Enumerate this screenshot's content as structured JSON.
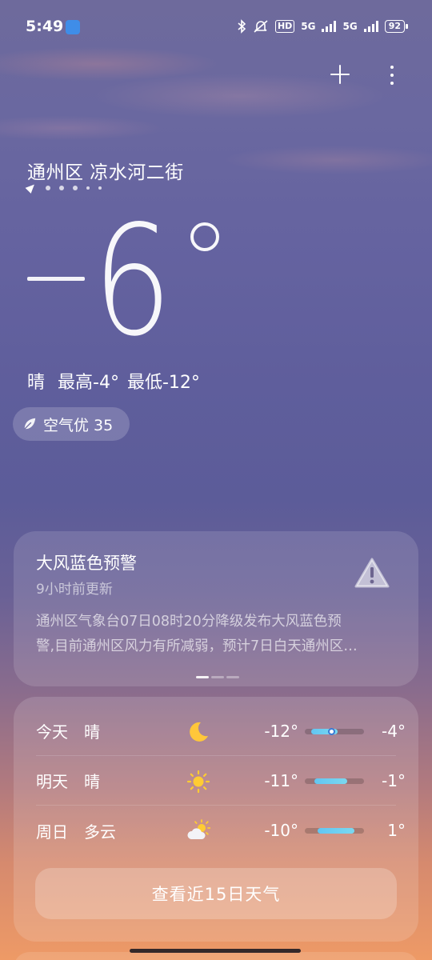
{
  "status_bar": {
    "time": "5:49",
    "hd_label": "HD",
    "network_1": "5G",
    "network_2": "5G",
    "battery": "92"
  },
  "location": {
    "name": "通州区 凉水河二街",
    "page_count": 6,
    "current_page": 0
  },
  "current": {
    "temperature_sign": "-",
    "temperature_value": "6",
    "condition": "晴",
    "high": "最高-4°",
    "low": "最低-12°",
    "aqi_label": "空气优 35"
  },
  "alert": {
    "title": "大风蓝色预警",
    "updated": "9小时前更新",
    "text_line1": "通州区气象台07日08时20分降级发布大风蓝色预",
    "text_line2": "警,目前通州区风力有所减弱，预计7日白天通州区…",
    "pager_count": 3,
    "pager_active": 0
  },
  "forecast": {
    "rows": [
      {
        "day": "今天",
        "condition": "晴",
        "icon": "moon-icon",
        "low": "-12°",
        "high": "-4°",
        "low_value": -12,
        "high_value": -4,
        "current_value": -6
      },
      {
        "day": "明天",
        "condition": "晴",
        "icon": "sun-icon",
        "low": "-11°",
        "high": "-1°",
        "low_value": -11,
        "high_value": -1
      },
      {
        "day": "周日",
        "condition": "多云",
        "icon": "partly-cloudy-icon",
        "low": "-10°",
        "high": "1°",
        "low_value": -10,
        "high_value": 1
      }
    ],
    "view15_label": "查看近15日天气"
  },
  "colors": {
    "bar_fill": "#62c6f2",
    "sun": "#ffcc33",
    "moon": "#ffc73a"
  }
}
